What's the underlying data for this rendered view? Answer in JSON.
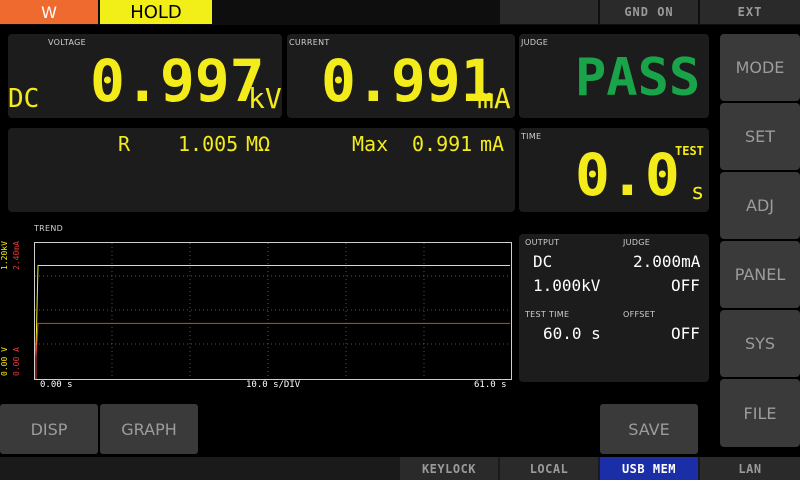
{
  "topbar": {
    "mode_indicator": "W",
    "hold_label": "HOLD",
    "gnd_label": "GND ON",
    "ext_label": "EXT"
  },
  "voltage": {
    "label": "VOLTAGE",
    "type": "DC",
    "value": "0.997",
    "unit": "kV"
  },
  "current": {
    "label": "CURRENT",
    "value": "0.991",
    "unit": "mA"
  },
  "judge": {
    "label": "JUDGE",
    "value": "PASS"
  },
  "resistance": {
    "label": "R",
    "value": "1.005",
    "unit": "MΩ"
  },
  "max_current": {
    "label": "Max",
    "value": "0.991",
    "unit": "mA"
  },
  "time": {
    "label": "TIME",
    "status": "TEST",
    "value": "0.0",
    "unit": "s"
  },
  "trend": {
    "label": "TREND",
    "y_volt_max": "1.20kV",
    "y_curr_max": "2.40mA",
    "y_volt_min": "0.00 V",
    "y_curr_min": "0.00 A",
    "x_start": "0.00 s",
    "x_div": "10.0 s/DIV",
    "x_end": "61.0 s",
    "voltage_level_fraction": 0.83,
    "current_level_fraction": 0.41
  },
  "settings": {
    "output_label": "OUTPUT",
    "output_type": "DC",
    "output_voltage": "1.000kV",
    "judge_label": "JUDGE",
    "judge_limit": "2.000mA",
    "judge_lower": "OFF",
    "test_time_label": "TEST TIME",
    "test_time_value": "60.0 s",
    "offset_label": "OFFSET",
    "offset_value": "OFF"
  },
  "side_menu": [
    "MODE",
    "SET",
    "ADJ",
    "PANEL",
    "SYS",
    "FILE"
  ],
  "bottom_buttons": {
    "disp": "DISP",
    "graph": "GRAPH",
    "save": "SAVE"
  },
  "status_bar": {
    "keylock": "KEYLOCK",
    "local": "LOCAL",
    "usb_mem": "USB MEM",
    "lan": "LAN"
  },
  "colors": {
    "yellow": "#f4ec1a",
    "pass_green": "#1aa44a",
    "current_trace": "#e03a3a",
    "usb_active": "#1a2ea8",
    "w_tab": "#ee6a2e"
  }
}
